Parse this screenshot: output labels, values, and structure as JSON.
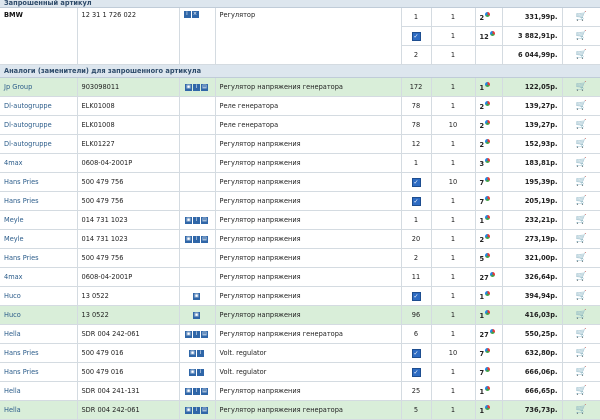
{
  "header_top": "Запрошенный артикул",
  "requested": {
    "brand": "BMW",
    "article": "12 31 1 726 022",
    "description": "Регулятор",
    "offers": [
      {
        "qty": "1",
        "min": "1",
        "days": "2",
        "price": "331,99р.",
        "checked": false
      },
      {
        "qty": "",
        "min": "1",
        "days": "12",
        "price": "3 882,91р.",
        "checked": true
      },
      {
        "qty": "2",
        "min": "1",
        "days": "",
        "price": "6 044,99р.",
        "checked": false
      }
    ]
  },
  "analogs_header": "Аналоги (заменители) для запрошенного артикула",
  "analogs": [
    {
      "brand": "Jp Group",
      "article": "903098011",
      "icons": 3,
      "description": "Регулятор напряжения генератора",
      "qty": "172",
      "min": "1",
      "days": "1",
      "price": "122,05р.",
      "checked": false,
      "hl": true
    },
    {
      "brand": "Dl-autogruppe",
      "article": "ELK01008",
      "icons": 0,
      "description": "Реле генератора",
      "qty": "78",
      "min": "1",
      "days": "2",
      "price": "139,27р.",
      "checked": false,
      "hl": false
    },
    {
      "brand": "Dl-autogruppe",
      "article": "ELK01008",
      "icons": 0,
      "description": "Реле генератора",
      "qty": "78",
      "min": "10",
      "days": "2",
      "price": "139,27р.",
      "checked": false,
      "hl": false
    },
    {
      "brand": "Dl-autogruppe",
      "article": "ELK01227",
      "icons": 0,
      "description": "Регулятор напряжения",
      "qty": "12",
      "min": "1",
      "days": "2",
      "price": "152,93р.",
      "checked": false,
      "hl": false
    },
    {
      "brand": "4max",
      "article": "0608-04-2001P",
      "icons": 0,
      "description": "Регулятор напряжения",
      "qty": "1",
      "min": "1",
      "days": "3",
      "price": "183,81р.",
      "checked": false,
      "hl": false
    },
    {
      "brand": "Hans Pries",
      "article": "500 479 756",
      "icons": 0,
      "description": "Регулятор напряжения",
      "qty": "",
      "min": "10",
      "days": "7",
      "price": "195,39р.",
      "checked": true,
      "hl": false
    },
    {
      "brand": "Hans Pries",
      "article": "500 479 756",
      "icons": 0,
      "description": "Регулятор напряжения",
      "qty": "",
      "min": "1",
      "days": "7",
      "price": "205,19р.",
      "checked": true,
      "hl": false
    },
    {
      "brand": "Meyle",
      "article": "014 731 1023",
      "icons": 3,
      "description": "Регулятор напряжения",
      "qty": "1",
      "min": "1",
      "days": "1",
      "price": "232,21р.",
      "checked": false,
      "hl": false
    },
    {
      "brand": "Meyle",
      "article": "014 731 1023",
      "icons": 3,
      "description": "Регулятор напряжения",
      "qty": "20",
      "min": "1",
      "days": "2",
      "price": "273,19р.",
      "checked": false,
      "hl": false
    },
    {
      "brand": "Hans Pries",
      "article": "500 479 756",
      "icons": 0,
      "description": "Регулятор напряжения",
      "qty": "2",
      "min": "1",
      "days": "5",
      "price": "321,00р.",
      "checked": false,
      "hl": false
    },
    {
      "brand": "4max",
      "article": "0608-04-2001P",
      "icons": 0,
      "description": "Регулятор напряжения",
      "qty": "11",
      "min": "1",
      "days": "27",
      "price": "326,64р.",
      "checked": false,
      "hl": false
    },
    {
      "brand": "Huco",
      "article": "13 0522",
      "icons": 1,
      "description": "Регулятор напряжения",
      "qty": "",
      "min": "1",
      "days": "1",
      "price": "394,94р.",
      "checked": true,
      "hl": false
    },
    {
      "brand": "Huco",
      "article": "13 0522",
      "icons": 1,
      "description": "Регулятор напряжения",
      "qty": "96",
      "min": "1",
      "days": "1",
      "price": "416,03р.",
      "checked": false,
      "hl": true
    },
    {
      "brand": "Hella",
      "article": "SDR 004 242-061",
      "icons": 3,
      "description": "Регулятор напряжения генератора",
      "qty": "6",
      "min": "1",
      "days": "27",
      "price": "550,25р.",
      "checked": false,
      "hl": false
    },
    {
      "brand": "Hans Pries",
      "article": "500 479 016",
      "icons": 2,
      "description": "Volt. regulator",
      "qty": "",
      "min": "10",
      "days": "7",
      "price": "632,80р.",
      "checked": true,
      "hl": false
    },
    {
      "brand": "Hans Pries",
      "article": "500 479 016",
      "icons": 2,
      "description": "Volt. regulator",
      "qty": "",
      "min": "1",
      "days": "7",
      "price": "666,06р.",
      "checked": true,
      "hl": false
    },
    {
      "brand": "Hella",
      "article": "SDR 004 241-131",
      "icons": 3,
      "description": "Регулятор напряжения",
      "qty": "25",
      "min": "1",
      "days": "1",
      "price": "666,65р.",
      "checked": false,
      "hl": false
    },
    {
      "brand": "Hella",
      "article": "SDR 004 242-061",
      "icons": 3,
      "description": "Регулятор напряжения генератора",
      "qty": "5",
      "min": "1",
      "days": "1",
      "price": "736,73р.",
      "checked": false,
      "hl": true
    }
  ]
}
